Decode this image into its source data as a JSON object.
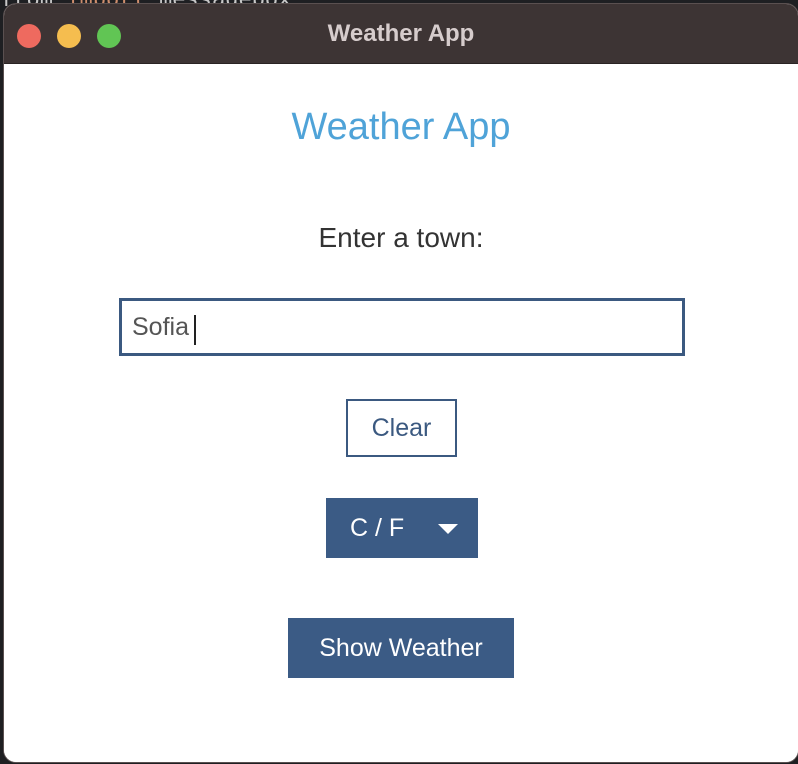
{
  "window": {
    "title": "Weather App"
  },
  "background": {
    "code_keyword": "import",
    "code_rest": "messagebox",
    "code_prefix": "from"
  },
  "app": {
    "heading": "Weather App",
    "prompt": "Enter a town:",
    "town_input_value": "Sofia",
    "clear_label": "Clear",
    "unit_selected": "C / F",
    "show_label": "Show Weather"
  },
  "colors": {
    "heading": "#4fa3d8",
    "accent": "#3b5b85",
    "titlebar": "#3d3434"
  }
}
